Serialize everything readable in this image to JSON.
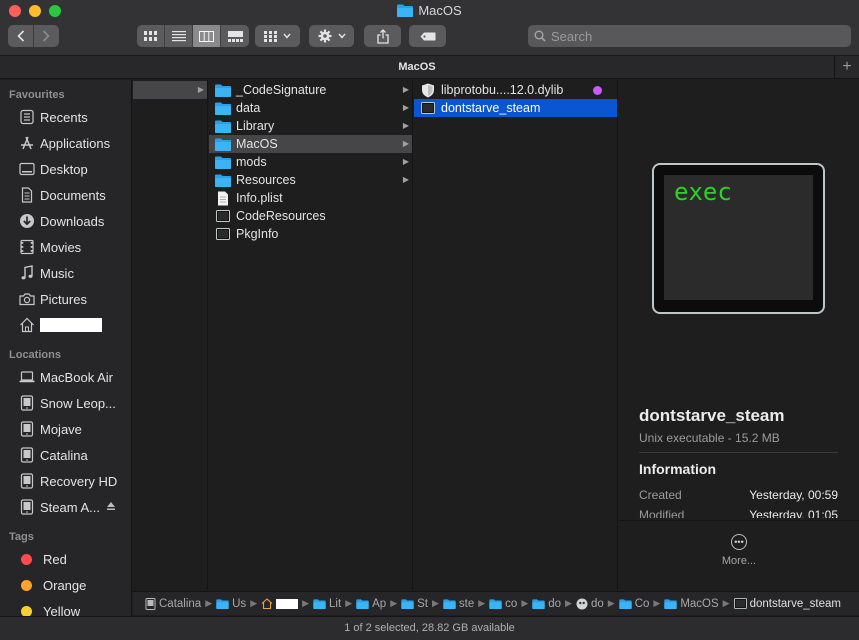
{
  "window": {
    "title": "MacOS",
    "folder_color": "#2aa0e8"
  },
  "toolbar": {
    "search_placeholder": "Search"
  },
  "tabbar": {
    "tab_label": "MacOS",
    "add_label": "+"
  },
  "sidebar": {
    "favourites_header": "Favourites",
    "favourites": [
      {
        "label": "Recents",
        "icon": "clock-icon"
      },
      {
        "label": "Applications",
        "icon": "applications-icon"
      },
      {
        "label": "Desktop",
        "icon": "desktop-icon"
      },
      {
        "label": "Documents",
        "icon": "document-icon"
      },
      {
        "label": "Downloads",
        "icon": "download-icon"
      },
      {
        "label": "Movies",
        "icon": "film-icon"
      },
      {
        "label": "Music",
        "icon": "music-icon"
      },
      {
        "label": "Pictures",
        "icon": "camera-icon"
      },
      {
        "label": "",
        "icon": "home-icon",
        "redacted": true
      }
    ],
    "locations_header": "Locations",
    "locations": [
      {
        "label": "MacBook Air",
        "icon": "laptop-icon"
      },
      {
        "label": "Snow Leop...",
        "icon": "disk-icon"
      },
      {
        "label": "Mojave",
        "icon": "disk-icon"
      },
      {
        "label": "Catalina",
        "icon": "disk-icon"
      },
      {
        "label": "Recovery HD",
        "icon": "disk-icon"
      },
      {
        "label": "Steam A...",
        "icon": "disk-icon",
        "eject": true
      }
    ],
    "tags_header": "Tags",
    "tags": [
      {
        "label": "Red",
        "color": "#fe4b4b"
      },
      {
        "label": "Orange",
        "color": "#fda42b"
      },
      {
        "label": "Yellow",
        "color": "#f8d12f"
      }
    ]
  },
  "columns": {
    "col2": [
      {
        "label": "_CodeSignature",
        "kind": "folder"
      },
      {
        "label": "data",
        "kind": "folder"
      },
      {
        "label": "Library",
        "kind": "folder"
      },
      {
        "label": "MacOS",
        "kind": "folder",
        "selected": true
      },
      {
        "label": "mods",
        "kind": "folder"
      },
      {
        "label": "Resources",
        "kind": "folder"
      },
      {
        "label": "Info.plist",
        "kind": "file"
      },
      {
        "label": "CodeResources",
        "kind": "exec"
      },
      {
        "label": "PkgInfo",
        "kind": "exec"
      }
    ],
    "col3": [
      {
        "label": "libprotobu....12.0.dylib",
        "kind": "dylib",
        "tag_color": "#c95cf7"
      },
      {
        "label": "dontstarve_steam",
        "kind": "exec",
        "selected": true
      }
    ]
  },
  "preview": {
    "icon_text": "exec",
    "name": "dontstarve_steam",
    "kind": "Unix executable - 15.2 MB",
    "info_header": "Information",
    "created_label": "Created",
    "created_value": "Yesterday, 00:59",
    "modified_label": "Modified",
    "modified_value": "Yesterday, 01:05",
    "more_label": "More..."
  },
  "pathbar": {
    "crumbs": [
      {
        "label": "Catalina",
        "icon": "disk-icon"
      },
      {
        "label": "Us",
        "icon": "folder-icon"
      },
      {
        "label": "",
        "icon": "home-icon",
        "redacted": true
      },
      {
        "label": "Lit",
        "icon": "folder-icon"
      },
      {
        "label": "Ap",
        "icon": "folder-icon"
      },
      {
        "label": "St",
        "icon": "folder-icon"
      },
      {
        "label": "ste",
        "icon": "folder-icon"
      },
      {
        "label": "co",
        "icon": "folder-icon"
      },
      {
        "label": "do",
        "icon": "folder-icon"
      },
      {
        "label": "do",
        "icon": "app-icon"
      },
      {
        "label": "Co",
        "icon": "folder-icon"
      },
      {
        "label": "MacOS",
        "icon": "folder-icon"
      },
      {
        "label": "dontstarve_steam",
        "icon": "exec-icon"
      }
    ]
  },
  "status": {
    "text": "1 of 2 selected, 28.82 GB available"
  }
}
